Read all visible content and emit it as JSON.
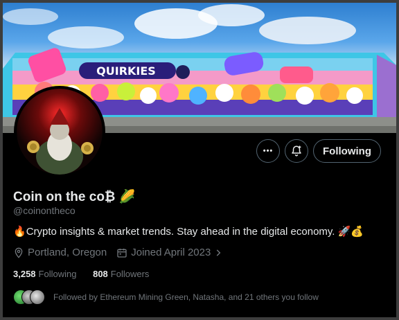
{
  "profile": {
    "name": "Coin on the co₿",
    "name_emoji": "🌽",
    "handle": "@coinontheco",
    "bio_lead_emoji": "🔥",
    "bio": "Crypto insights & market trends. Stay ahead in the digital economy.",
    "bio_trail_emoji": "🚀💰",
    "location": "Portland, Oregon",
    "joined": "Joined April 2023",
    "following_count": "3,258",
    "following_label": "Following",
    "followers_count": "808",
    "followers_label": "Followers",
    "followed_by": "Followed by Ethereum Mining Green, Natasha, and 21 others you follow"
  },
  "actions": {
    "more_label": "•••",
    "follow_label": "Following"
  },
  "icons": {
    "more": "more-icon",
    "notify": "bell-plus-icon",
    "location": "location-pin-icon",
    "calendar": "calendar-icon",
    "chevron": "chevron-right-icon"
  },
  "colors": {
    "background": "#000000",
    "text": "#e7e9ea",
    "muted": "#71767b",
    "border": "#536471"
  }
}
